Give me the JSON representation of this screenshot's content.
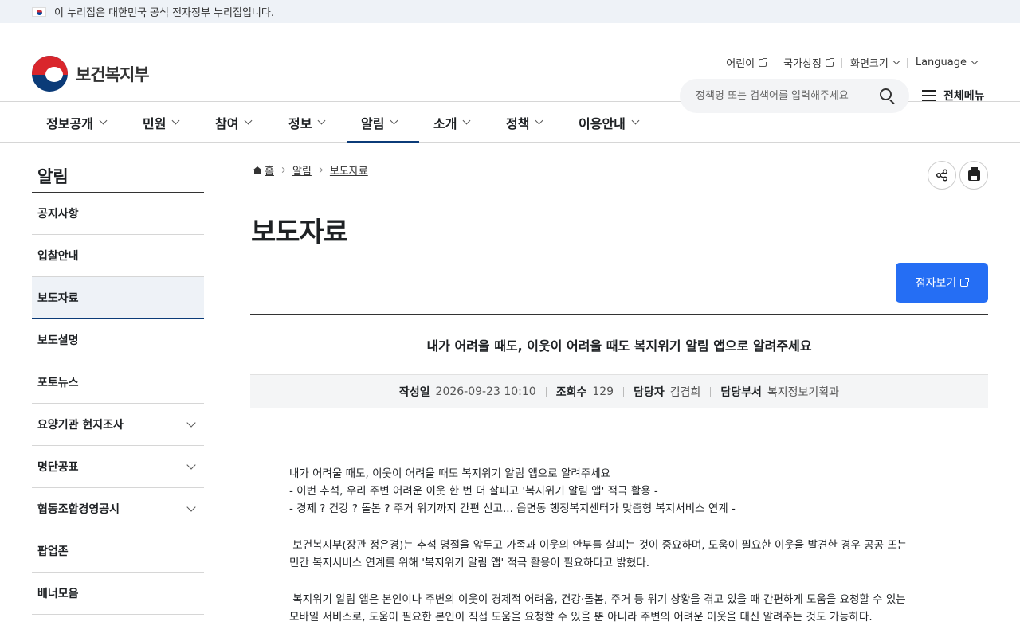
{
  "gov_bar": {
    "text": "이 누리집은 대한민국 공식 전자정부 누리집입니다."
  },
  "util": {
    "kids": "어린이",
    "symbols": "국가상징",
    "screen_size": "화면크기",
    "language": "Language"
  },
  "logo": {
    "text": "보건복지부"
  },
  "search": {
    "placeholder": "정책명 또는 검색어를 입력해주세요"
  },
  "all_menu": "전체메뉴",
  "gnb": [
    "정보공개",
    "민원",
    "참여",
    "정보",
    "알림",
    "소개",
    "정책",
    "이용안내"
  ],
  "lnb": {
    "title": "알림",
    "items": [
      "공지사항",
      "입찰안내",
      "보도자료",
      "보도설명",
      "포토뉴스",
      "요양기관 현지조사",
      "명단공표",
      "협동조합경영공시",
      "팝업존",
      "배너모음"
    ]
  },
  "breadcrumb": [
    "홈",
    "알림",
    "보도자료"
  ],
  "page_title": "보도자료",
  "braille_button": "점자보기",
  "article": {
    "title": "내가 어려울 때도, 이웃이 어려울 때도 복지위기 알림 앱으로 알려주세요",
    "meta": {
      "date_label": "작성일",
      "date": "2026-09-23 10:10",
      "views_label": "조회수",
      "views": "129",
      "author_label": "담당자",
      "author": "김겸희",
      "dept_label": "담당부서",
      "dept": "복지정보기획과"
    },
    "body": [
      "내가 어려울 때도, 이웃이 어려울 때도 복지위기 알림 앱으로 알려주세요",
      "- 이번 추석, 우리 주변 어려운 이웃 한 번 더 살피고 '복지위기 알림 앱' 적극 활용 -",
      "- 경제 ? 건강 ? 돌봄 ? 주거 위기까지 간편 신고... 읍면동 행정복지센터가 맞춤형 복지서비스 연계 -",
      " 보건복지부(장관 정은경)는 추석 명절을 앞두고 가족과 이웃의 안부를 살피는 것이 중요하며, 도움이 필요한 이웃을 발견한 경우 공공 또는",
      "민간 복지서비스 연계를 위해 '복지위기 알림 앱' 적극 활용이 필요하다고 밝혔다.",
      " 복지위기 알림 앱은 본인이나 주변의 이웃이 경제적 어려움, 건강·돌봄, 주거 등 위기 상황을 겪고 있을 때 간편하게 도움을 요청할 수 있는",
      "모바일 서비스로, 도움이 필요한 본인이 직접 도움을 요청할 수 있을 뿐 아니라 주변의 어려운 이웃을 대신 알려주는 것도 가능하다."
    ]
  }
}
